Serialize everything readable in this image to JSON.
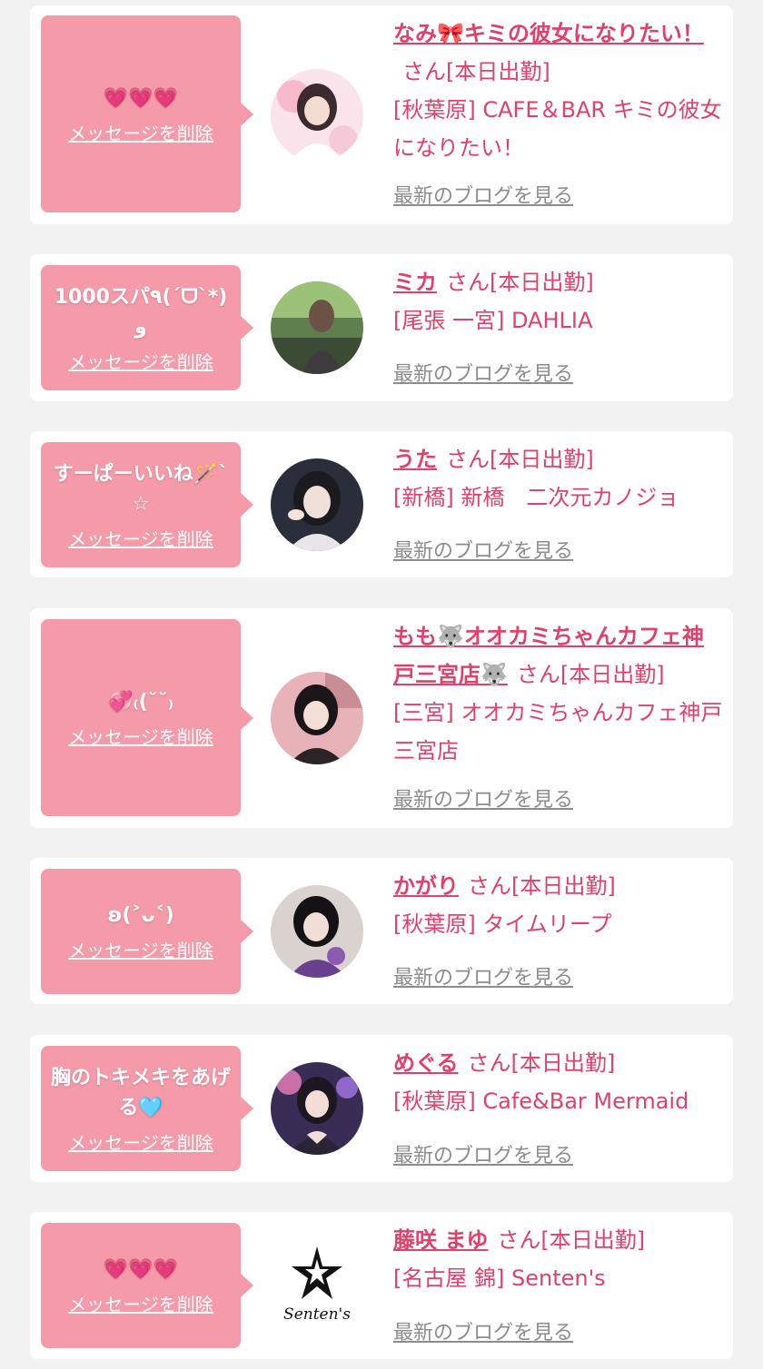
{
  "colors": {
    "page_bg": "#f2f2f2",
    "card_bg": "#ffffff",
    "bubble_bg": "#f59aa9",
    "accent_pink": "#e0406a",
    "link_gray": "#8c8c8c"
  },
  "delete_label": "メッセージを削除",
  "san_label": "さん",
  "blog_label": "最新のブログを見る",
  "messages": [
    {
      "message": "💗💗💗",
      "name": "なみ🎀キミの彼女になりたい！",
      "status": "[本日出勤]",
      "shop": "[秋葉原] CAFE＆BAR キミの彼女になりたい！",
      "avatar_icon": "cast-photo-icon"
    },
    {
      "message": "1000スパ٩(ˊᗜˋ*)و",
      "name": "ミカ",
      "status": "[本日出勤]",
      "shop": "[尾張 一宮] DAHLIA",
      "avatar_icon": "cast-photo-icon"
    },
    {
      "message": "すーぱーいいね🪄`☆",
      "name": "うた",
      "status": "[本日出勤]",
      "shop": "[新橋] 新橋　二次元カノジョ",
      "avatar_icon": "cast-photo-icon"
    },
    {
      "message": "💞₍(˘˘₎",
      "name": "もも🐺オオカミちゃんカフェ神戸三宮店🐺",
      "status": "[本日出勤]",
      "shop": "[三宮] オオカミちゃんカフェ神戸三宮店",
      "avatar_icon": "cast-photo-icon"
    },
    {
      "message": "ʚ(˃ᴗ˂)",
      "name": "かがり",
      "status": "[本日出勤]",
      "shop": "[秋葉原] タイムリープ",
      "avatar_icon": "cast-photo-icon"
    },
    {
      "message": "胸のトキメキをあげる🩵",
      "name": "めぐる",
      "status": "[本日出勤]",
      "shop": "[秋葉原] Cafe&Bar Mermaid",
      "avatar_icon": "cast-photo-icon"
    },
    {
      "message": "💗💗💗",
      "name": "藤咲 まゆ",
      "status": "[本日出勤]",
      "shop": "[名古屋 錦] Senten's",
      "avatar_icon": "senten-logo",
      "logo_text": "Senten's"
    }
  ]
}
